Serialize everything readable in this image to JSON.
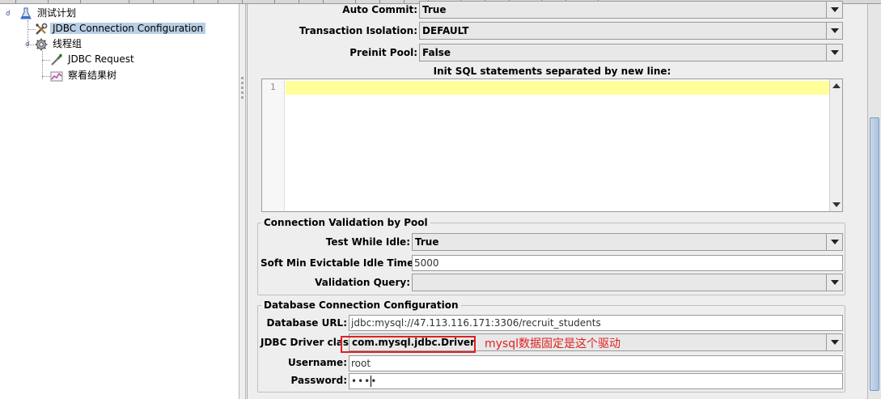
{
  "tree": {
    "nodes": [
      {
        "label": "测试计划",
        "icon": "test-plan-icon"
      },
      {
        "label": "JDBC Connection Configuration",
        "icon": "tools-icon",
        "selected": true
      },
      {
        "label": "线程组",
        "icon": "gear-icon"
      },
      {
        "label": "JDBC Request",
        "icon": "pipette-icon"
      },
      {
        "label": "察看结果树",
        "icon": "chart-icon"
      }
    ]
  },
  "pool": {
    "auto_commit_label": "Auto Commit:",
    "auto_commit_value": "True",
    "transaction_isolation_label": "Transaction Isolation:",
    "transaction_isolation_value": "DEFAULT",
    "preinit_pool_label": "Preinit Pool:",
    "preinit_pool_value": "False",
    "init_sql_label": "Init SQL statements separated by new line:",
    "init_sql_line_number": "1"
  },
  "validation": {
    "title": "Connection Validation by Pool",
    "test_while_idle_label": "Test While Idle:",
    "test_while_idle_value": "True",
    "soft_min_label": "Soft Min Evictable Idle Time(ms):",
    "soft_min_value": "5000",
    "validation_query_label": "Validation Query:",
    "validation_query_value": ""
  },
  "database": {
    "title": "Database Connection Configuration",
    "url_label": "Database URL:",
    "url_value": "jdbc:mysql://47.113.116.171:3306/recruit_students",
    "driver_label": "JDBC Driver class:",
    "driver_value": "com.mysql.jdbc.Driver",
    "username_label": "Username:",
    "username_value": "root",
    "password_label": "Password:",
    "password_value": "••••"
  },
  "annotation": {
    "text": "mysql数据固定是这个驱动",
    "color": "#e02020"
  },
  "colors": {
    "selection": "#b8cfe5",
    "editor_current_line": "#ffff99"
  }
}
